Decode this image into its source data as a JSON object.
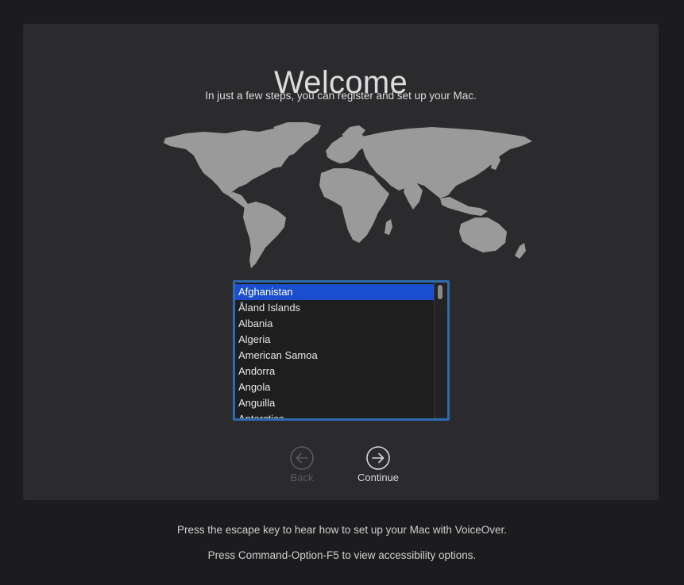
{
  "welcome": {
    "title": "Welcome",
    "subtitle": "In just a few steps, you can register and set up your Mac."
  },
  "country_list": {
    "items": [
      "Afghanistan",
      "Åland Islands",
      "Albania",
      "Algeria",
      "American Samoa",
      "Andorra",
      "Angola",
      "Anguilla",
      "Antarctica"
    ],
    "selected": "Afghanistan"
  },
  "navigation": {
    "back_label": "Back",
    "continue_label": "Continue",
    "back_enabled": false,
    "back_icon": "arrow-left-circle-icon",
    "continue_icon": "arrow-right-circle-icon"
  },
  "footer": {
    "voiceover_hint": "Press the escape key to hear how to set up your Mac with VoiceOver.",
    "accessibility_hint": "Press Command-Option-F5 to view accessibility options."
  },
  "colors": {
    "background": "#1c1c1e",
    "panel": "#2b2b2d",
    "map_land": "#9a9a9a",
    "selection": "#1c4fd0",
    "focus_ring": "#2d6bb0"
  }
}
